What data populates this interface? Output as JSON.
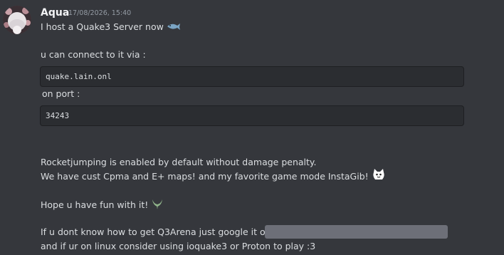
{
  "message": {
    "author": "Aqua",
    "timestamp": "17/08/2026, 15:40",
    "lines": [
      "I host a Quake3 Server now",
      "u can connect to it via :",
      "on port :",
      "Rocketjumping is enabled by default without damage penalty.",
      "We have cust Cpma and E+ maps! and my favorite game mode InstaGib!",
      "Hope u have fun with it!",
      "If u dont know how to get Q3Arena just google it or :",
      "and if ur on linux consider using ioquake3 or Proton to play :3"
    ],
    "code_blocks": [
      "quake.lain.onl",
      "34243"
    ]
  },
  "icons": {
    "avatar": "avatar-image",
    "emoji_1": "fish-emoji",
    "emoji_2": "cat-emoji",
    "emoji_3": "quake-logo-emoji"
  },
  "colors": {
    "background": "#35373c",
    "codeblock": "#2b2d31",
    "spoiler": "#6d6f78",
    "author": "#f2f3f5",
    "text": "#dbdee1",
    "timestamp": "#949ba4"
  }
}
